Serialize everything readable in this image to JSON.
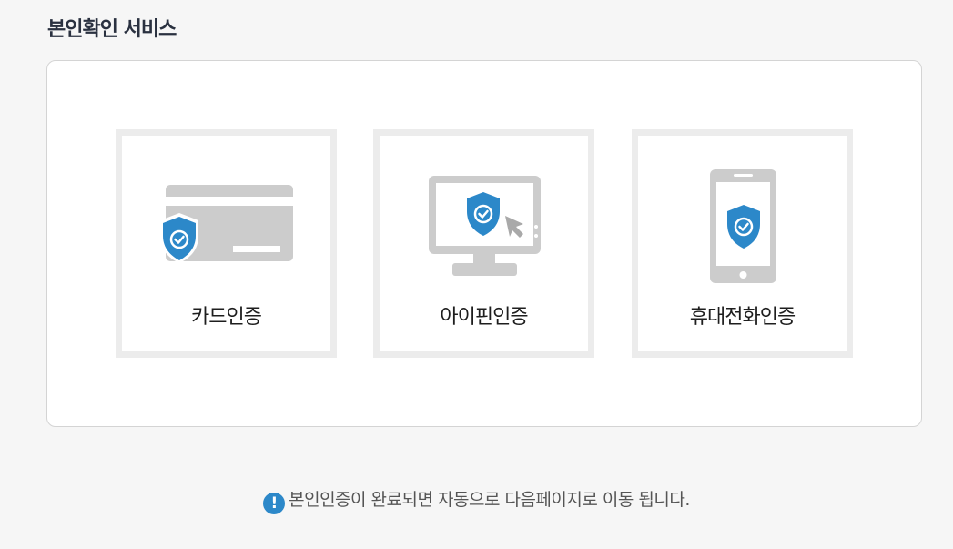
{
  "section": {
    "title": "본인확인 서비스"
  },
  "options": [
    {
      "label": "카드인증",
      "icon": "card-shield-icon"
    },
    {
      "label": "아이핀인증",
      "icon": "monitor-shield-icon"
    },
    {
      "label": "휴대전화인증",
      "icon": "phone-shield-icon"
    }
  ],
  "notice": {
    "icon": "exclamation-icon",
    "text": "본인인증이 완료되면 자동으로 다음페이지로 이동 됩니다."
  },
  "colors": {
    "accent": "#2c88c9",
    "icon_gray": "#cccccc",
    "card_border": "#ececec"
  }
}
